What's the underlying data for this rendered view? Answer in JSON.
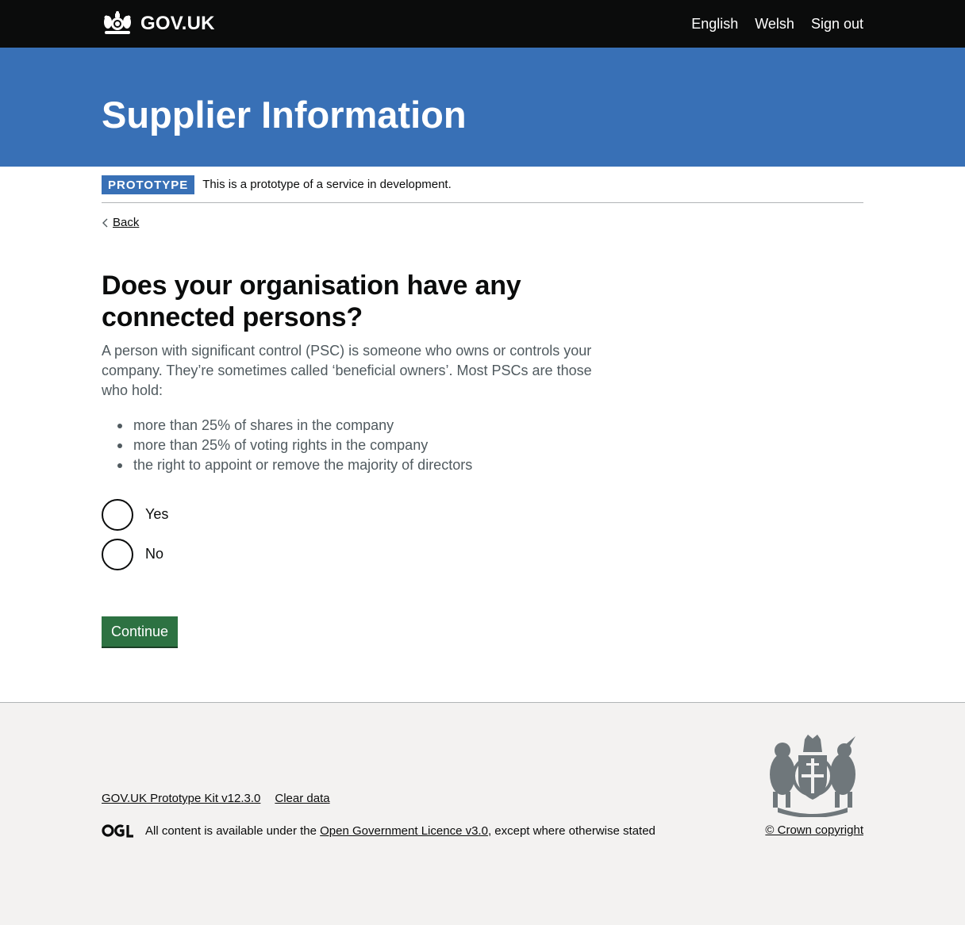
{
  "header": {
    "logo_text": "GOV.UK",
    "nav": [
      {
        "label": "English"
      },
      {
        "label": "Welsh"
      },
      {
        "label": "Sign out"
      }
    ]
  },
  "banner": {
    "title": "Supplier Information"
  },
  "phase_banner": {
    "tag": "PROTOTYPE",
    "text": "This is a prototype of a service in development."
  },
  "back_link": {
    "label": "Back"
  },
  "question": {
    "heading": "Does your organisation have any connected persons?",
    "hint": "A person with significant control (PSC) is someone who owns or controls your company. They’re sometimes called ‘beneficial owners’. Most PSCs are those who hold:",
    "bullets": [
      "more than 25% of shares in the company",
      "more than 25% of voting rights in the company",
      "the right to appoint or remove the majority of directors"
    ],
    "options": [
      {
        "label": "Yes",
        "selected": false
      },
      {
        "label": "No",
        "selected": false
      }
    ]
  },
  "continue_button": {
    "label": "Continue"
  },
  "footer": {
    "links": [
      {
        "label": "GOV.UK Prototype Kit v12.3.0"
      },
      {
        "label": "Clear data"
      }
    ],
    "licence_prefix": "All content is available under the ",
    "licence_link": "Open Government Licence v3.0",
    "licence_suffix": ", except where otherwise stated",
    "copyright": "© Crown copyright"
  },
  "colors": {
    "header_bg": "#0b0c0c",
    "banner_bg": "#3870b6",
    "button_green": "#2d7242",
    "hint_text": "#505a5f",
    "footer_bg": "#f3f2f1"
  }
}
